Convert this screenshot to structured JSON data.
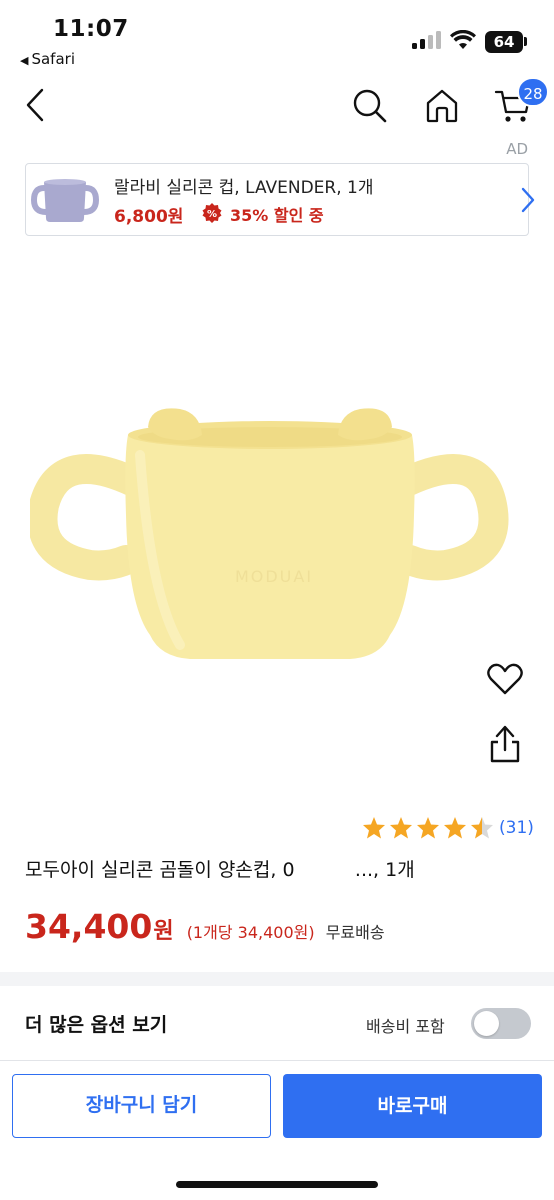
{
  "status_bar": {
    "time": "11:07",
    "back_app": "Safari",
    "battery": "64"
  },
  "nav": {
    "cart_count": "28",
    "icons": [
      "back-chevron-icon",
      "search-icon",
      "home-icon",
      "cart-icon"
    ]
  },
  "ad": {
    "label": "AD",
    "product_name": "랄라비 실리콘 컵, LAVENDER, 1개",
    "price": "6,800원",
    "discount": "35% 할인 중",
    "sale_icon_text": "%"
  },
  "product": {
    "rating": 4.5,
    "review_count": "(31)",
    "title": "모두아이 실리콘 곰돌이 양손컵, 0          ..., 1개",
    "price": "34,400",
    "price_unit": "원",
    "unit_price": "(1개당 34,400원)",
    "shipping": "무료배송"
  },
  "options": {
    "label": "더 많은 옵션 보기",
    "shipping_included_label": "배송비 포함",
    "shipping_included_on": false
  },
  "actions": {
    "add_to_cart": "장바구니 담기",
    "buy_now": "바로구매"
  },
  "colors": {
    "accent": "#2f6ff1",
    "price_red": "#c9261c",
    "cup_yellow": "#f8eba5",
    "lavender": "#a9a9cf"
  }
}
